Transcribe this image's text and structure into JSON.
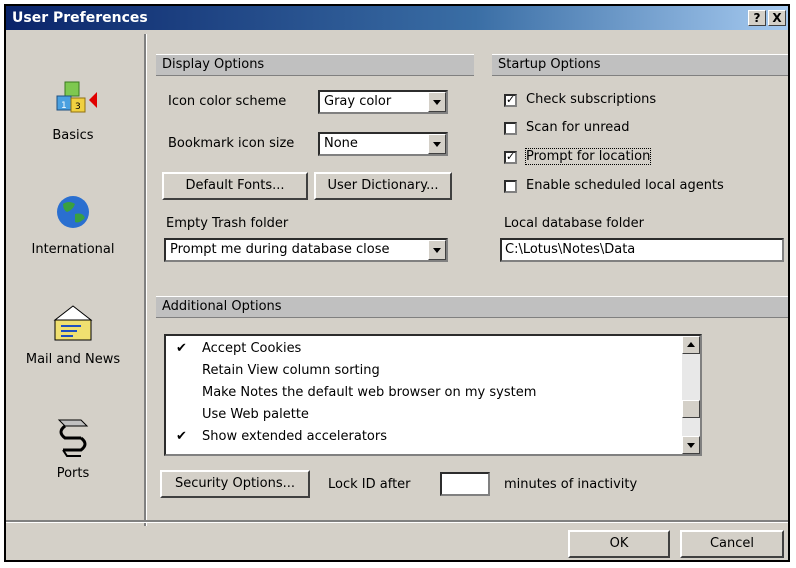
{
  "window": {
    "title": "User Preferences",
    "help_label": "?",
    "close_label": "X"
  },
  "sidebar": {
    "items": [
      {
        "label": "Basics",
        "icon": "blocks-icon",
        "selected": true
      },
      {
        "label": "International",
        "icon": "globe-icon"
      },
      {
        "label": "Mail and News",
        "icon": "mail-icon"
      },
      {
        "label": "Ports",
        "icon": "ports-icon"
      }
    ]
  },
  "display": {
    "header": "Display Options",
    "icon_color_label": "Icon color scheme",
    "icon_color_value": "Gray color",
    "bookmark_size_label": "Bookmark icon size",
    "bookmark_size_value": "None",
    "default_fonts_label": "Default Fonts...",
    "user_dictionary_label": "User Dictionary...",
    "empty_trash_label": "Empty Trash folder",
    "empty_trash_value": "Prompt me during database close"
  },
  "startup": {
    "header": "Startup Options",
    "options": [
      {
        "label": "Check subscriptions",
        "checked": true
      },
      {
        "label": "Scan for unread",
        "checked": false
      },
      {
        "label": "Prompt for location",
        "checked": true
      },
      {
        "label": "Enable scheduled local agents",
        "checked": false
      }
    ],
    "local_db_label": "Local database folder",
    "local_db_value": "C:\\Lotus\\Notes\\Data"
  },
  "additional": {
    "header": "Additional Options",
    "items": [
      {
        "label": "Accept Cookies",
        "checked": true
      },
      {
        "label": "Retain View column sorting",
        "checked": false
      },
      {
        "label": "Make Notes the default web browser on my system",
        "checked": false
      },
      {
        "label": "Use Web palette",
        "checked": false
      },
      {
        "label": "Show extended accelerators",
        "checked": true
      }
    ],
    "check_glyph": "✔"
  },
  "security": {
    "button_label": "Security Options...",
    "lock_label": "Lock ID after",
    "lock_value": "",
    "minutes_label": "minutes of inactivity"
  },
  "footer": {
    "ok_label": "OK",
    "cancel_label": "Cancel"
  }
}
